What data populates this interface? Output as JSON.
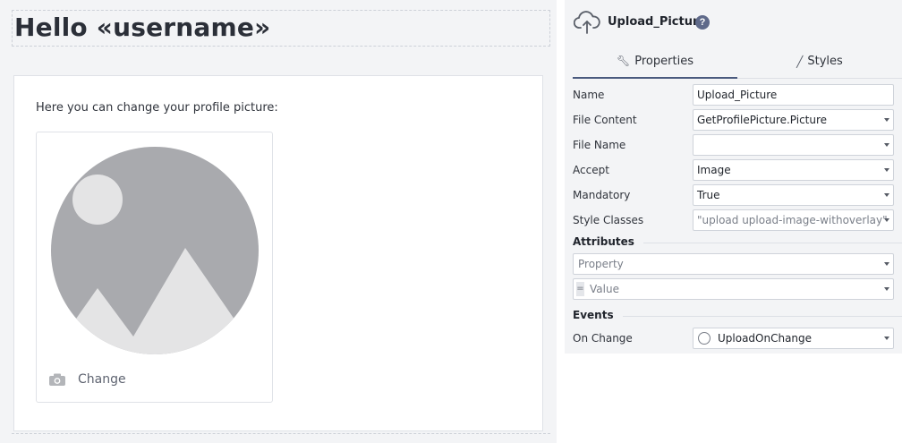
{
  "canvas": {
    "title": "Hello «username»",
    "description": "Here you can change your profile picture:",
    "change_label": "Change"
  },
  "panel": {
    "widget_name": "Upload_Picture",
    "help_glyph": "?",
    "tabs": [
      {
        "label": "Properties",
        "icon": "wrench-icon",
        "active": true
      },
      {
        "label": "Styles",
        "icon": "brush-icon",
        "active": false
      }
    ],
    "properties": [
      {
        "label": "Name",
        "value": "Upload_Picture",
        "has_dropdown": false
      },
      {
        "label": "File Content",
        "value": "GetProfilePicture.Picture",
        "has_dropdown": true
      },
      {
        "label": "File Name",
        "value": "",
        "has_dropdown": true
      },
      {
        "label": "Accept",
        "value": "Image",
        "has_dropdown": true
      },
      {
        "label": "Mandatory",
        "value": "True",
        "has_dropdown": true
      },
      {
        "label": "Style Classes",
        "value": "\"upload upload-image-withoverlay\"",
        "has_dropdown": true
      }
    ],
    "attributes": {
      "section_label": "Attributes",
      "property_placeholder": "Property",
      "value_prefix": "=",
      "value_placeholder": "Value"
    },
    "events": {
      "section_label": "Events",
      "label": "On Change",
      "value": "UploadOnChange"
    }
  },
  "colors": {
    "accent": "#4a5a7e",
    "panel_bg": "#f3f4f6",
    "placeholder_gray": "#a9aaae"
  }
}
